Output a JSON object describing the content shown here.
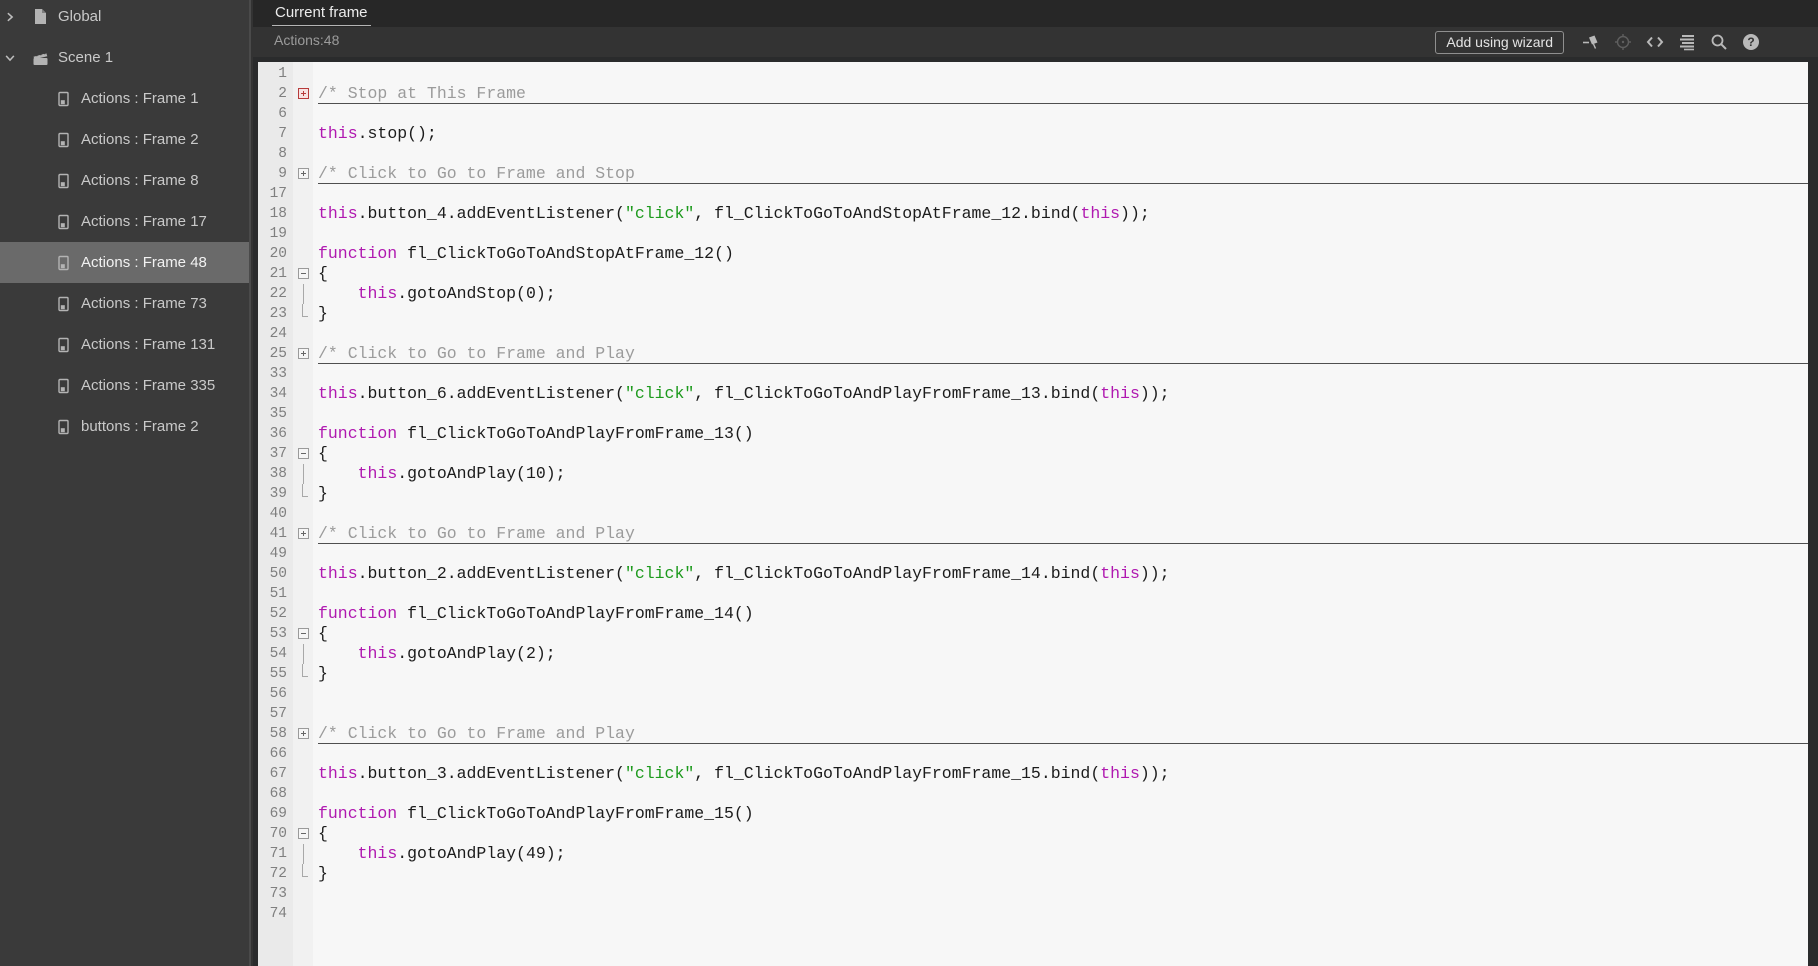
{
  "colors": {
    "keyword": "#b019b0",
    "string": "#1d9a1d",
    "comment": "#9b9b9b",
    "code_default": "#1c1c1c",
    "sidebar_bg": "#3a3a3a",
    "selected_bg": "#6a6a6a",
    "gutter_bg": "#eaeaea",
    "editor_bg": "#f7f7f7"
  },
  "header": {
    "tab": "Current frame",
    "context": "Actions:48",
    "wizard_button": "Add using wizard",
    "icons": [
      "pin-icon",
      "target-icon",
      "code-icon",
      "format-icon",
      "search-icon",
      "help-icon"
    ]
  },
  "sidebar": {
    "items": [
      {
        "label": "Global",
        "level": 0,
        "icon": "page",
        "chevron": "right",
        "selected": false
      },
      {
        "label": "Scene 1",
        "level": 0,
        "icon": "clapper",
        "chevron": "down",
        "selected": false
      },
      {
        "label": "Actions : Frame 1",
        "level": 1,
        "icon": "script",
        "selected": false
      },
      {
        "label": "Actions : Frame 2",
        "level": 1,
        "icon": "script",
        "selected": false
      },
      {
        "label": "Actions : Frame 8",
        "level": 1,
        "icon": "script",
        "selected": false
      },
      {
        "label": "Actions : Frame 17",
        "level": 1,
        "icon": "script",
        "selected": false
      },
      {
        "label": "Actions : Frame 48",
        "level": 1,
        "icon": "script",
        "selected": true
      },
      {
        "label": "Actions : Frame 73",
        "level": 1,
        "icon": "script",
        "selected": false
      },
      {
        "label": "Actions : Frame 131",
        "level": 1,
        "icon": "script",
        "selected": false
      },
      {
        "label": "Actions : Frame 335",
        "level": 1,
        "icon": "script",
        "selected": false
      },
      {
        "label": "buttons : Frame 2",
        "level": 1,
        "icon": "script",
        "selected": false
      }
    ]
  },
  "editor": {
    "lines": [
      {
        "n": "1",
        "segs": []
      },
      {
        "n": "2",
        "fold": "plus-red",
        "underline": true,
        "segs": [
          {
            "c": "cm",
            "t": "/* Stop at This Frame"
          }
        ]
      },
      {
        "n": "6",
        "segs": []
      },
      {
        "n": "7",
        "segs": [
          {
            "c": "k",
            "t": "this"
          },
          {
            "c": "d",
            "t": ".stop();"
          }
        ]
      },
      {
        "n": "8",
        "segs": []
      },
      {
        "n": "9",
        "fold": "plus",
        "underline": true,
        "segs": [
          {
            "c": "cm",
            "t": "/* Click to Go to Frame and Stop"
          }
        ]
      },
      {
        "n": "17",
        "segs": []
      },
      {
        "n": "18",
        "segs": [
          {
            "c": "k",
            "t": "this"
          },
          {
            "c": "d",
            "t": ".button_4.addEventListener("
          },
          {
            "c": "s",
            "t": "\"click\""
          },
          {
            "c": "d",
            "t": ", fl_ClickToGoToAndStopAtFrame_12.bind("
          },
          {
            "c": "k",
            "t": "this"
          },
          {
            "c": "d",
            "t": "));"
          }
        ]
      },
      {
        "n": "19",
        "segs": []
      },
      {
        "n": "20",
        "segs": [
          {
            "c": "k",
            "t": "function"
          },
          {
            "c": "d",
            "t": " fl_ClickToGoToAndStopAtFrame_12()"
          }
        ]
      },
      {
        "n": "21",
        "fold": "minus",
        "segs": [
          {
            "c": "d",
            "t": "{"
          }
        ]
      },
      {
        "n": "22",
        "fold": "pipe",
        "segs": [
          {
            "c": "d",
            "t": "    "
          },
          {
            "c": "k",
            "t": "this"
          },
          {
            "c": "d",
            "t": ".gotoAndStop(0);"
          }
        ]
      },
      {
        "n": "23",
        "fold": "end",
        "segs": [
          {
            "c": "d",
            "t": "}"
          }
        ]
      },
      {
        "n": "24",
        "segs": []
      },
      {
        "n": "25",
        "fold": "plus",
        "underline": true,
        "segs": [
          {
            "c": "cm",
            "t": "/* Click to Go to Frame and Play"
          }
        ]
      },
      {
        "n": "33",
        "segs": []
      },
      {
        "n": "34",
        "segs": [
          {
            "c": "k",
            "t": "this"
          },
          {
            "c": "d",
            "t": ".button_6.addEventListener("
          },
          {
            "c": "s",
            "t": "\"click\""
          },
          {
            "c": "d",
            "t": ", fl_ClickToGoToAndPlayFromFrame_13.bind("
          },
          {
            "c": "k",
            "t": "this"
          },
          {
            "c": "d",
            "t": "));"
          }
        ]
      },
      {
        "n": "35",
        "segs": []
      },
      {
        "n": "36",
        "segs": [
          {
            "c": "k",
            "t": "function"
          },
          {
            "c": "d",
            "t": " fl_ClickToGoToAndPlayFromFrame_13()"
          }
        ]
      },
      {
        "n": "37",
        "fold": "minus",
        "segs": [
          {
            "c": "d",
            "t": "{"
          }
        ]
      },
      {
        "n": "38",
        "fold": "pipe",
        "segs": [
          {
            "c": "d",
            "t": "    "
          },
          {
            "c": "k",
            "t": "this"
          },
          {
            "c": "d",
            "t": ".gotoAndPlay(10);"
          }
        ]
      },
      {
        "n": "39",
        "fold": "end",
        "segs": [
          {
            "c": "d",
            "t": "}"
          }
        ]
      },
      {
        "n": "40",
        "segs": []
      },
      {
        "n": "41",
        "fold": "plus",
        "underline": true,
        "segs": [
          {
            "c": "cm",
            "t": "/* Click to Go to Frame and Play"
          }
        ]
      },
      {
        "n": "49",
        "segs": []
      },
      {
        "n": "50",
        "segs": [
          {
            "c": "k",
            "t": "this"
          },
          {
            "c": "d",
            "t": ".button_2.addEventListener("
          },
          {
            "c": "s",
            "t": "\"click\""
          },
          {
            "c": "d",
            "t": ", fl_ClickToGoToAndPlayFromFrame_14.bind("
          },
          {
            "c": "k",
            "t": "this"
          },
          {
            "c": "d",
            "t": "));"
          }
        ]
      },
      {
        "n": "51",
        "segs": []
      },
      {
        "n": "52",
        "segs": [
          {
            "c": "k",
            "t": "function"
          },
          {
            "c": "d",
            "t": " fl_ClickToGoToAndPlayFromFrame_14()"
          }
        ]
      },
      {
        "n": "53",
        "fold": "minus",
        "segs": [
          {
            "c": "d",
            "t": "{"
          }
        ]
      },
      {
        "n": "54",
        "fold": "pipe",
        "segs": [
          {
            "c": "d",
            "t": "    "
          },
          {
            "c": "k",
            "t": "this"
          },
          {
            "c": "d",
            "t": ".gotoAndPlay(2);"
          }
        ]
      },
      {
        "n": "55",
        "fold": "end",
        "segs": [
          {
            "c": "d",
            "t": "}"
          }
        ]
      },
      {
        "n": "56",
        "segs": []
      },
      {
        "n": "57",
        "segs": []
      },
      {
        "n": "58",
        "fold": "plus",
        "underline": true,
        "segs": [
          {
            "c": "cm",
            "t": "/* Click to Go to Frame and Play"
          }
        ]
      },
      {
        "n": "66",
        "segs": []
      },
      {
        "n": "67",
        "segs": [
          {
            "c": "k",
            "t": "this"
          },
          {
            "c": "d",
            "t": ".button_3.addEventListener("
          },
          {
            "c": "s",
            "t": "\"click\""
          },
          {
            "c": "d",
            "t": ", fl_ClickToGoToAndPlayFromFrame_15.bind("
          },
          {
            "c": "k",
            "t": "this"
          },
          {
            "c": "d",
            "t": "));"
          }
        ]
      },
      {
        "n": "68",
        "segs": []
      },
      {
        "n": "69",
        "segs": [
          {
            "c": "k",
            "t": "function"
          },
          {
            "c": "d",
            "t": " fl_ClickToGoToAndPlayFromFrame_15()"
          }
        ]
      },
      {
        "n": "70",
        "fold": "minus",
        "segs": [
          {
            "c": "d",
            "t": "{"
          }
        ]
      },
      {
        "n": "71",
        "fold": "pipe",
        "segs": [
          {
            "c": "d",
            "t": "    "
          },
          {
            "c": "k",
            "t": "this"
          },
          {
            "c": "d",
            "t": ".gotoAndPlay(49);"
          }
        ]
      },
      {
        "n": "72",
        "fold": "end",
        "segs": [
          {
            "c": "d",
            "t": "}"
          }
        ]
      },
      {
        "n": "73",
        "segs": []
      },
      {
        "n": "74",
        "segs": []
      }
    ]
  }
}
